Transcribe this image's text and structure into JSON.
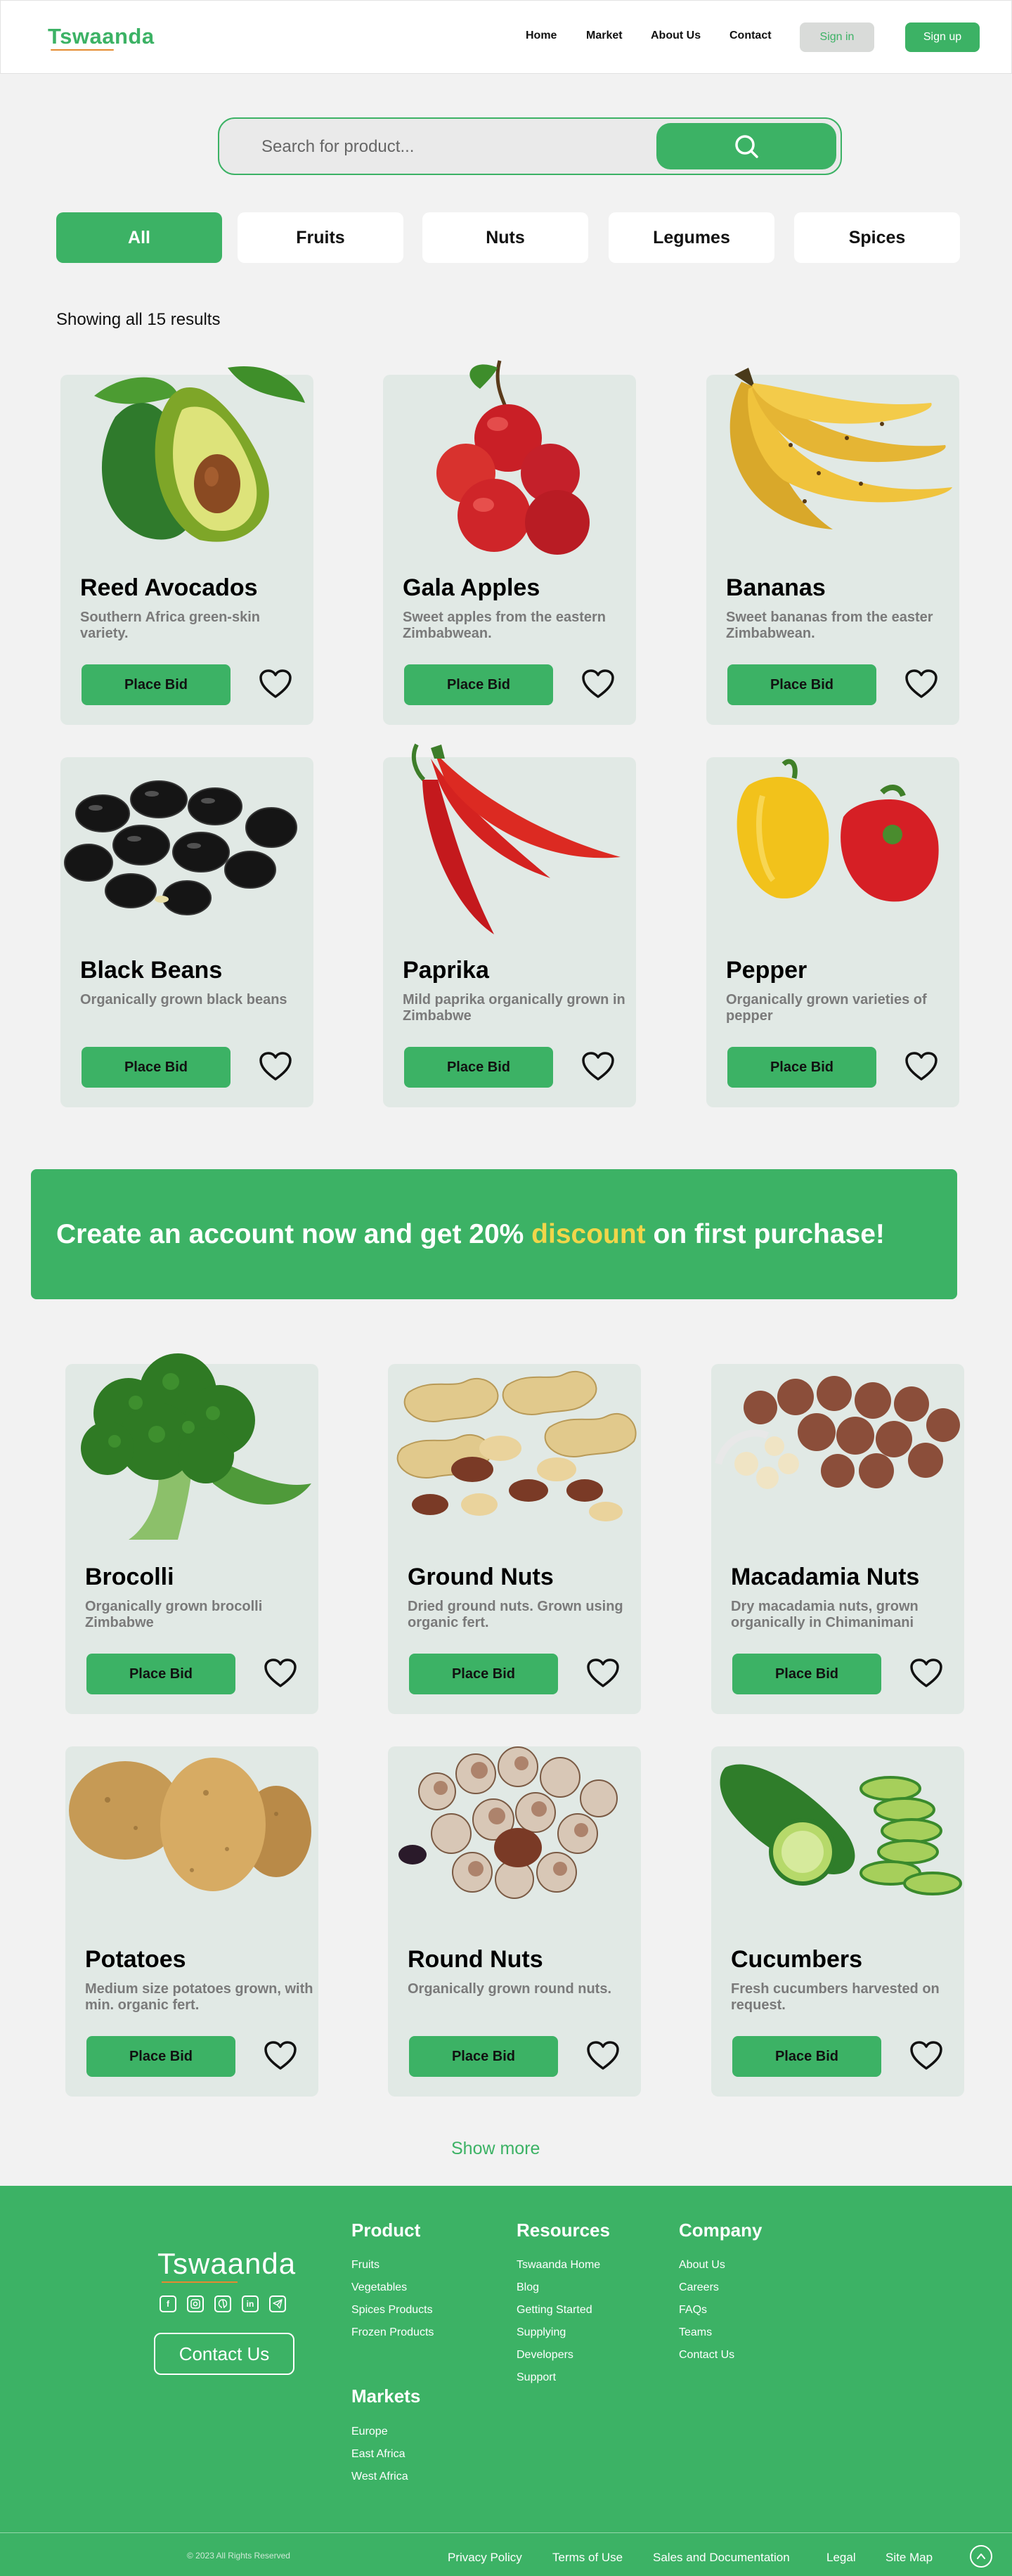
{
  "nav": {
    "logo": "Tswaanda",
    "links": [
      "Home",
      "Market",
      "About Us",
      "Contact"
    ],
    "signin": "Sign in",
    "signup": "Sign up"
  },
  "search": {
    "placeholder": "Search for product..."
  },
  "tabs": [
    "All",
    "Fruits",
    "Nuts",
    "Legumes",
    "Spices"
  ],
  "active_tab": "All",
  "results_text": "Showing all 15 results",
  "bid_label": "Place Bid",
  "products": [
    {
      "name": "Reed Avocados",
      "desc": "Southern Africa green-skin variety.",
      "image": "avocado"
    },
    {
      "name": "Gala Apples",
      "desc": "Sweet apples from the eastern Zimbabwean.",
      "image": "apples"
    },
    {
      "name": "Bananas",
      "desc": "Sweet bananas from the easter Zimbabwean.",
      "image": "bananas"
    },
    {
      "name": "Black Beans",
      "desc": "Organically grown black beans",
      "image": "black-beans"
    },
    {
      "name": "Paprika",
      "desc": "Mild paprika organically grown in Zimbabwe",
      "image": "paprika"
    },
    {
      "name": "Pepper",
      "desc": "Organically grown varieties of pepper",
      "image": "peppers"
    },
    {
      "name": "Brocolli",
      "desc": "Organically grown brocolli Zimbabwe",
      "image": "broccoli"
    },
    {
      "name": "Ground Nuts",
      "desc": "Dried ground nuts. Grown using organic fert.",
      "image": "ground-nuts"
    },
    {
      "name": "Macadamia Nuts",
      "desc": "Dry macadamia nuts, grown organically in Chimanimani",
      "image": "macadamia"
    },
    {
      "name": "Potatoes",
      "desc": "Medium size potatoes grown, with min. organic fert.",
      "image": "potatoes"
    },
    {
      "name": "Round Nuts",
      "desc": "Organically grown round nuts.",
      "image": "round-nuts"
    },
    {
      "name": "Cucumbers",
      "desc": "Fresh cucumbers harvested on request.",
      "image": "cucumbers"
    }
  ],
  "banner": {
    "before": "Create an account now and get 20% ",
    "highlight": "discount",
    "after": " on first purchase!"
  },
  "show_more": "Show more",
  "footer": {
    "logo": "Tswaanda",
    "social_icons": [
      "facebook-icon",
      "instagram-icon",
      "github-icon",
      "linkedin-icon",
      "telegram-icon"
    ],
    "contact_button": "Contact Us",
    "product": {
      "title": "Product",
      "links": [
        "Fruits",
        "Vegetables",
        "Spices Products",
        "Frozen Products"
      ]
    },
    "resources": {
      "title": "Resources",
      "links": [
        "Tswaanda Home",
        "Blog",
        "Getting Started",
        "Supplying",
        "Developers",
        "Support"
      ]
    },
    "company": {
      "title": "Company",
      "links": [
        "About Us",
        "Careers",
        "FAQs",
        "Teams",
        "Contact Us"
      ]
    },
    "markets": {
      "title": "Markets",
      "links": [
        "Europe",
        "East Africa",
        "West Africa"
      ]
    },
    "copyright": "© 2023 All Rights Reserved",
    "bottom_links": [
      "Privacy Policy",
      "Terms of Use",
      "Sales and Documentation",
      "Legal",
      "Site Map"
    ]
  },
  "colors": {
    "brand": "#3cb265",
    "card_bg": "#e1e9e5",
    "highlight": "#f1d64a",
    "logo_underline": "#e58a2f"
  }
}
